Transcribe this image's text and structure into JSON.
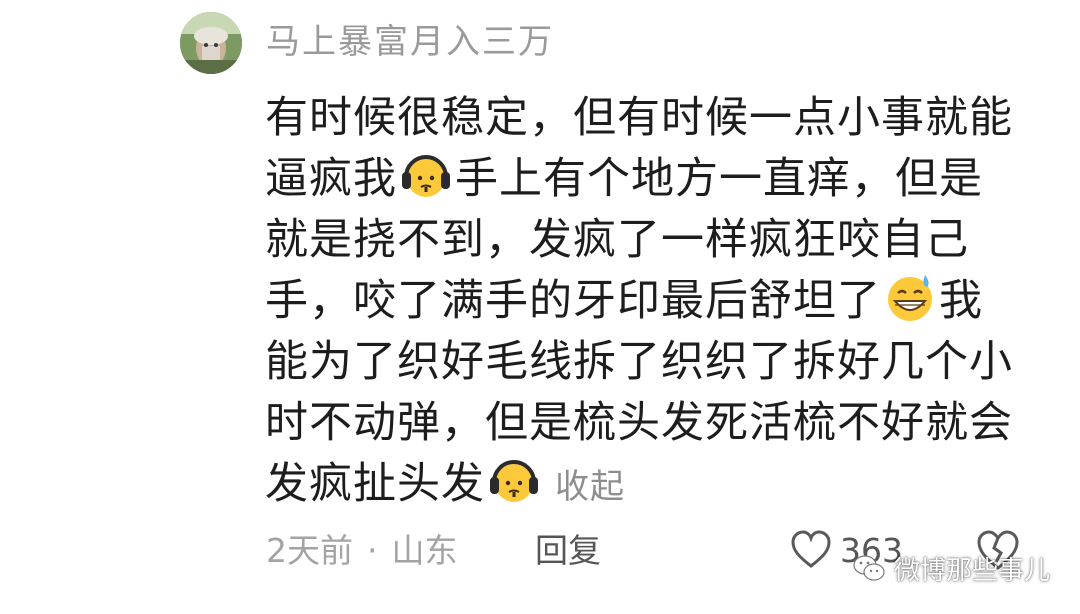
{
  "comment": {
    "username": "马上暴富月入三万",
    "lines": [
      {
        "text": "有时候很稳定，但有时候一点小事就能"
      },
      {
        "before": "逼疯我",
        "emoji": "headphones-face-emoji",
        "after": "手上有个地方一直痒，但是"
      },
      {
        "text": "就是挠不到，发疯了一样疯狂咬自己"
      },
      {
        "before": "手，咬了满手的牙印最后舒坦了",
        "emoji": "grin-sweat-emoji",
        "after": "我"
      },
      {
        "text": "能为了织好毛线拆了织织了拆好几个小"
      },
      {
        "text": "时不动弹，但是梳头发死活梳不好就会"
      },
      {
        "before": "发疯扯头发",
        "emoji": "headphones-face-emoji",
        "after": ""
      }
    ],
    "collapse_label": "收起",
    "time": "2天前",
    "separator": "·",
    "location": "山东",
    "reply_label": "回复",
    "like_count": "363"
  },
  "watermark": {
    "text": "微博那些事儿",
    "icon": "wechat-icon"
  },
  "colors": {
    "username": "#9a9a9a",
    "body_text": "#1d1d1d",
    "meta_text": "#a3a3a3",
    "emoji_yellow": "#fbc93a"
  }
}
